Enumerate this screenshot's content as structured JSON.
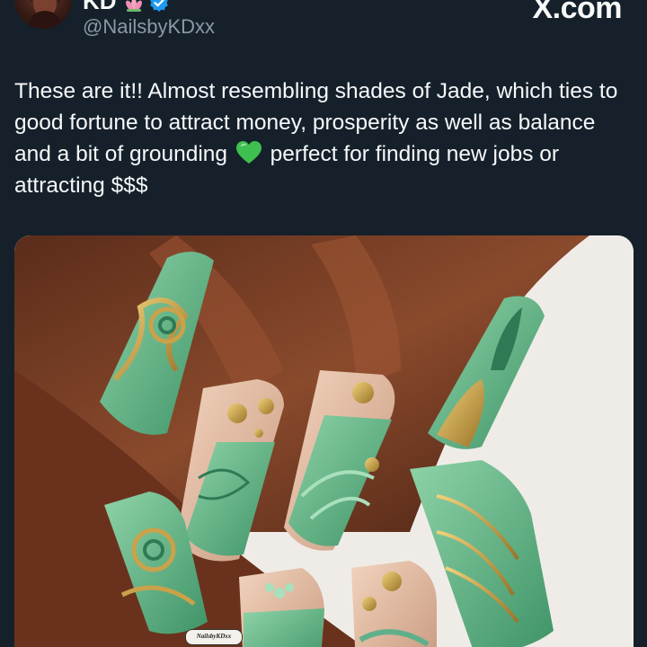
{
  "author": {
    "display_name": "KD",
    "name_emoji": "lotus-icon",
    "verified": true,
    "handle": "@NailsbyKDxx"
  },
  "brand": {
    "label": "X.com"
  },
  "tweet": {
    "text_before_emoji": "These are it!! Almost resembling shades of Jade, which ties to good fortune to attract money, prosperity as well as balance and a bit of grounding",
    "emoji": "green-heart-icon",
    "text_after_emoji": "perfect for finding new jobs or attracting $$$"
  },
  "media": {
    "watermark": "NailsbyKDxx",
    "colors": {
      "skin_dark": "#4a2416",
      "skin_mid": "#7a3e25",
      "jade": "#5fb08a",
      "jade_dark": "#2f7a55",
      "gold": "#c9a24a",
      "nude": "#e8c2a8",
      "background": "#efece8"
    }
  },
  "theme": {
    "background": "#15202b",
    "text": "#f7f9f9",
    "secondary_text": "#8b98a5",
    "verified": "#1d9bf0"
  }
}
